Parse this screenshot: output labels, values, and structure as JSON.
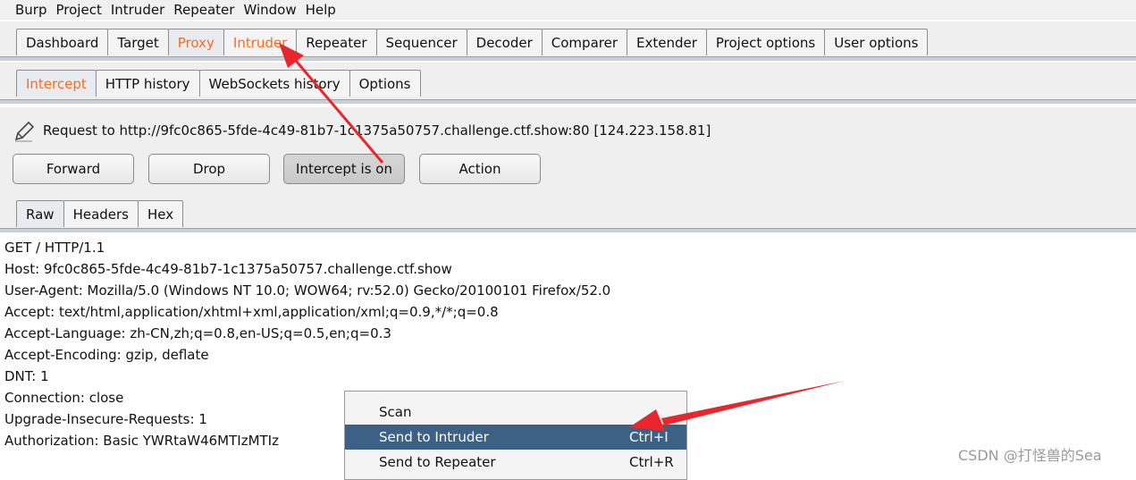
{
  "menubar": [
    "Burp",
    "Project",
    "Intruder",
    "Repeater",
    "Window",
    "Help"
  ],
  "main_tabs": [
    {
      "label": "Dashboard",
      "state": "normal"
    },
    {
      "label": "Target",
      "state": "normal"
    },
    {
      "label": "Proxy",
      "state": "active"
    },
    {
      "label": "Intruder",
      "state": "highlight"
    },
    {
      "label": "Repeater",
      "state": "normal"
    },
    {
      "label": "Sequencer",
      "state": "normal"
    },
    {
      "label": "Decoder",
      "state": "normal"
    },
    {
      "label": "Comparer",
      "state": "normal"
    },
    {
      "label": "Extender",
      "state": "normal"
    },
    {
      "label": "Project options",
      "state": "normal"
    },
    {
      "label": "User options",
      "state": "normal"
    }
  ],
  "proxy_tabs": [
    {
      "label": "Intercept",
      "state": "active"
    },
    {
      "label": "HTTP history",
      "state": "normal"
    },
    {
      "label": "WebSockets history",
      "state": "normal"
    },
    {
      "label": "Options",
      "state": "normal"
    }
  ],
  "intercept": {
    "request_label": "Request to http://9fc0c865-5fde-4c49-81b7-1c1375a50757.challenge.ctf.show:80  [124.223.158.81]",
    "buttons": {
      "forward": "Forward",
      "drop": "Drop",
      "intercept_toggle": "Intercept is on",
      "action": "Action"
    }
  },
  "message_tabs": [
    {
      "label": "Raw",
      "state": "active"
    },
    {
      "label": "Headers",
      "state": "normal"
    },
    {
      "label": "Hex",
      "state": "normal"
    }
  ],
  "request_lines": [
    "GET / HTTP/1.1",
    "Host: 9fc0c865-5fde-4c49-81b7-1c1375a50757.challenge.ctf.show",
    "User-Agent: Mozilla/5.0 (Windows NT 10.0; WOW64; rv:52.0) Gecko/20100101 Firefox/52.0",
    "Accept: text/html,application/xhtml+xml,application/xml;q=0.9,*/*;q=0.8",
    "Accept-Language: zh-CN,zh;q=0.8,en-US;q=0.5,en;q=0.3",
    "Accept-Encoding: gzip, deflate",
    "DNT: 1",
    "Connection: close",
    "Upgrade-Insecure-Requests: 1",
    "Authorization: Basic YWRtaW46MTIzMTIz"
  ],
  "context_menu": [
    {
      "label": "Scan",
      "shortcut": "",
      "selected": false
    },
    {
      "label": "Send to Intruder",
      "shortcut": "Ctrl+I",
      "selected": true
    },
    {
      "label": "Send to Repeater",
      "shortcut": "Ctrl+R",
      "selected": false
    }
  ],
  "watermark": "CSDN @打怪兽的Sea",
  "colors": {
    "accent_orange": "#ff6a1a",
    "menu_selected": "#3d6185",
    "annotation_red": "#e8262b"
  }
}
